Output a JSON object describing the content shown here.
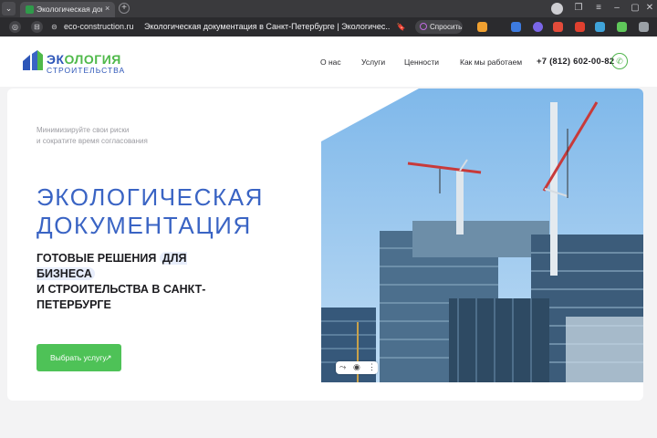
{
  "browser": {
    "tab_title": "Экологическая докум",
    "tab_close": "×",
    "new_tab": "+",
    "url": "eco-construction.ru",
    "page_title": "Экологическая документация в Санкт-Петербурге | Экологичес...",
    "ask_label": "Спросить"
  },
  "site": {
    "logo_top_a": "ЭК",
    "logo_top_b": "ОЛОГИЯ",
    "logo_bottom": "СТРОИТЕЛЬСТВА",
    "nav": [
      "О нас",
      "Услуги",
      "Ценности",
      "Как мы работаем"
    ],
    "phone": "+7 (812) 602-00-82"
  },
  "hero": {
    "subtitle_line1": "Минимизируйте свои риски",
    "subtitle_line2": "и сократите время согласования",
    "title_line1": "ЭКОЛОГИЧЕСКАЯ",
    "title_line2": "ДОКУМЕНТАЦИЯ",
    "lead_a": "ГОТОВЫЕ РЕШЕНИЯ",
    "lead_pill": "ДЛЯ БИЗНЕСА",
    "lead_b": "И СТРОИТЕЛЬСТВА В САНКТ-",
    "lead_c": "ПЕТЕРБУРГЕ",
    "cta_label": "Выбрать услугу",
    "cta_arrow": "↗"
  },
  "colors": {
    "brand_blue": "#3a64c4",
    "brand_green": "#4ec257",
    "browser_dark": "#2b2b2e"
  },
  "icons": [
    "back-icon",
    "favicon",
    "close-icon",
    "plus-icon",
    "shield-icon",
    "bookmark-icon",
    "ask-icon",
    "phone-icon",
    "camera-icon",
    "more-icon"
  ]
}
